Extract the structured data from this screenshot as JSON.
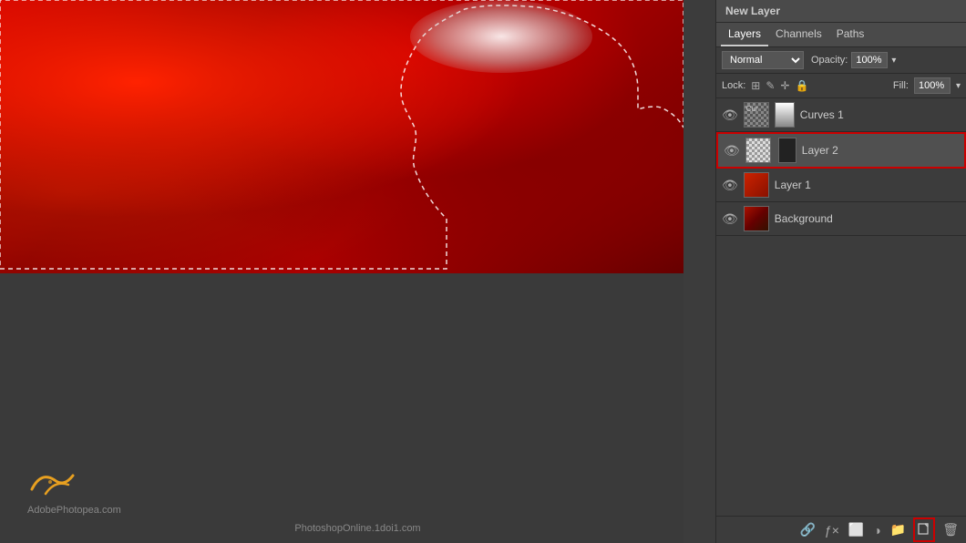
{
  "panel": {
    "title": "New Layer",
    "tabs": [
      {
        "label": "Layers",
        "active": true
      },
      {
        "label": "Channels",
        "active": false
      },
      {
        "label": "Paths",
        "active": false
      }
    ],
    "blend_mode": "Normal",
    "opacity_label": "Opacity:",
    "opacity_value": "100%",
    "lock_label": "Lock:",
    "lock_icons": [
      "grid",
      "brush",
      "move",
      "lock"
    ],
    "fill_label": "Fill:",
    "fill_value": "100%"
  },
  "layers": [
    {
      "name": "Curves 1",
      "visible": true,
      "thumb_type": "curves",
      "selected": false,
      "has_mask": false,
      "display_name": "Curves 1"
    },
    {
      "name": "Layer 2",
      "visible": true,
      "thumb_type": "layer2",
      "selected": true,
      "has_mask": true,
      "display_name": "Layer 2"
    },
    {
      "name": "Layer 1",
      "visible": true,
      "thumb_type": "layer1",
      "selected": false,
      "has_mask": false,
      "display_name": "Layer 1"
    },
    {
      "name": "Background",
      "visible": true,
      "thumb_type": "bg",
      "selected": false,
      "has_mask": false,
      "display_name": "Background"
    }
  ],
  "bottom_toolbar": {
    "icons": [
      "link",
      "fx",
      "mask",
      "new-group",
      "new-layer",
      "delete"
    ],
    "new_layer_highlighted": true
  },
  "watermarks": {
    "left_text": "AdobePhotopea.com",
    "center_text": "PhotoshopOnline.1doi1.com"
  },
  "curves_label": "Cur"
}
